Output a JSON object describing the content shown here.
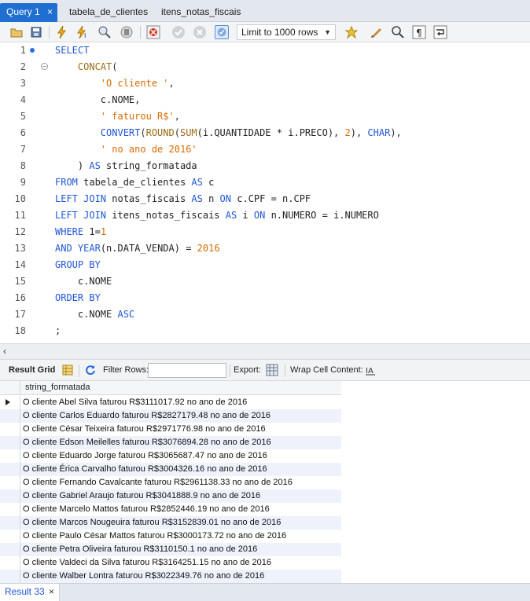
{
  "tabs": [
    {
      "label": "Query 1",
      "active": true
    },
    {
      "label": "tabela_de_clientes",
      "active": false
    },
    {
      "label": "itens_notas_fiscais",
      "active": false
    }
  ],
  "toolbar": {
    "limit_label": "Limit to 1000 rows",
    "icons": [
      "open-folder-icon",
      "save-icon",
      "execute-icon",
      "execute-current-icon",
      "explain-icon",
      "stop-icon",
      "toggle-error-icon",
      "commit-icon",
      "rollback-icon",
      "autocommit-icon",
      "add-snippet-icon",
      "beautify-icon",
      "find-icon",
      "invisible-chars-icon",
      "wrap-icon"
    ]
  },
  "editor": {
    "lines": [
      {
        "n": "1",
        "tokens": [
          {
            "t": "SELECT",
            "c": "kw"
          }
        ]
      },
      {
        "n": "2",
        "tokens": [
          {
            "t": "    CONCAT",
            "c": "fn"
          },
          {
            "t": "(",
            "c": "op"
          }
        ]
      },
      {
        "n": "3",
        "tokens": [
          {
            "t": "        ",
            "c": "plain"
          },
          {
            "t": "'O cliente '",
            "c": "str"
          },
          {
            "t": ",",
            "c": "op"
          }
        ]
      },
      {
        "n": "4",
        "tokens": [
          {
            "t": "        c.NOME,",
            "c": "plain"
          }
        ]
      },
      {
        "n": "5",
        "tokens": [
          {
            "t": "        ",
            "c": "plain"
          },
          {
            "t": "' faturou R$'",
            "c": "str"
          },
          {
            "t": ",",
            "c": "op"
          }
        ]
      },
      {
        "n": "6",
        "tokens": [
          {
            "t": "        ",
            "c": "plain"
          },
          {
            "t": "CONVERT",
            "c": "kw"
          },
          {
            "t": "(",
            "c": "op"
          },
          {
            "t": "ROUND",
            "c": "fn"
          },
          {
            "t": "(",
            "c": "op"
          },
          {
            "t": "SUM",
            "c": "fn"
          },
          {
            "t": "(i.QUANTIDADE * i.PRECO), ",
            "c": "plain"
          },
          {
            "t": "2",
            "c": "num"
          },
          {
            "t": "), ",
            "c": "plain"
          },
          {
            "t": "CHAR",
            "c": "kw"
          },
          {
            "t": "),",
            "c": "plain"
          }
        ]
      },
      {
        "n": "7",
        "tokens": [
          {
            "t": "        ",
            "c": "plain"
          },
          {
            "t": "' no ano de 2016'",
            "c": "str"
          }
        ]
      },
      {
        "n": "8",
        "tokens": [
          {
            "t": "    ) ",
            "c": "plain"
          },
          {
            "t": "AS",
            "c": "kw"
          },
          {
            "t": " string_formatada",
            "c": "plain"
          }
        ]
      },
      {
        "n": "9",
        "tokens": [
          {
            "t": "FROM",
            "c": "kw"
          },
          {
            "t": " tabela_de_clientes ",
            "c": "plain"
          },
          {
            "t": "AS",
            "c": "kw"
          },
          {
            "t": " c",
            "c": "plain"
          }
        ]
      },
      {
        "n": "10",
        "tokens": [
          {
            "t": "LEFT JOIN",
            "c": "kw"
          },
          {
            "t": " notas_fiscais ",
            "c": "plain"
          },
          {
            "t": "AS",
            "c": "kw"
          },
          {
            "t": " n ",
            "c": "plain"
          },
          {
            "t": "ON",
            "c": "kw"
          },
          {
            "t": " c.CPF = n.CPF",
            "c": "plain"
          }
        ]
      },
      {
        "n": "11",
        "tokens": [
          {
            "t": "LEFT JOIN",
            "c": "kw"
          },
          {
            "t": " itens_notas_fiscais ",
            "c": "plain"
          },
          {
            "t": "AS",
            "c": "kw"
          },
          {
            "t": " i ",
            "c": "plain"
          },
          {
            "t": "ON",
            "c": "kw"
          },
          {
            "t": " n.NUMERO = i.NUMERO",
            "c": "plain"
          }
        ]
      },
      {
        "n": "12",
        "tokens": [
          {
            "t": "WHERE",
            "c": "kw"
          },
          {
            "t": " 1=",
            "c": "plain"
          },
          {
            "t": "1",
            "c": "num"
          }
        ]
      },
      {
        "n": "13",
        "tokens": [
          {
            "t": "AND",
            "c": "kw"
          },
          {
            "t": " ",
            "c": "plain"
          },
          {
            "t": "YEAR",
            "c": "kw"
          },
          {
            "t": "(n.DATA_VENDA) = ",
            "c": "plain"
          },
          {
            "t": "2016",
            "c": "num"
          }
        ]
      },
      {
        "n": "14",
        "tokens": [
          {
            "t": "GROUP BY",
            "c": "kw"
          }
        ]
      },
      {
        "n": "15",
        "tokens": [
          {
            "t": "    c.NOME",
            "c": "plain"
          }
        ]
      },
      {
        "n": "16",
        "tokens": [
          {
            "t": "ORDER BY",
            "c": "kw"
          }
        ]
      },
      {
        "n": "17",
        "tokens": [
          {
            "t": "    c.NOME ",
            "c": "plain"
          },
          {
            "t": "ASC",
            "c": "kw"
          }
        ]
      },
      {
        "n": "18",
        "tokens": [
          {
            "t": ";",
            "c": "plain"
          }
        ]
      }
    ]
  },
  "results_bar": {
    "result_grid": "Result Grid",
    "filter_rows": "Filter Rows:",
    "export": "Export:",
    "wrap_cell": "Wrap Cell Content:"
  },
  "grid": {
    "column": "string_formatada",
    "rows": [
      "O cliente Abel Silva  faturou R$3111017.92 no ano de 2016",
      "O cliente Carlos Eduardo faturou R$2827179.48 no ano de 2016",
      "O cliente César Teixeira faturou R$2971776.98 no ano de 2016",
      "O cliente Edson Meilelles faturou R$3076894.28 no ano de 2016",
      "O cliente Eduardo Jorge faturou R$3065687.47 no ano de 2016",
      "O cliente Érica Carvalho faturou R$3004326.16 no ano de 2016",
      "O cliente Fernando Cavalcante faturou R$2961138.33 no ano de 2016",
      "O cliente Gabriel Araujo faturou R$3041888.9 no ano de 2016",
      "O cliente Marcelo Mattos faturou R$2852446.19 no ano de 2016",
      "O cliente Marcos Nougeuira faturou R$3152839.01 no ano de 2016",
      "O cliente Paulo César Mattos faturou R$3000173.72 no ano de 2016",
      "O cliente Petra Oliveira faturou R$3110150.1 no ano de 2016",
      "O cliente Valdeci da Silva faturou R$3164251.15 no ano de 2016",
      "O cliente Walber Lontra faturou R$3022349.76 no ano de 2016"
    ]
  },
  "bottom_tab": {
    "label": "Result 33"
  }
}
